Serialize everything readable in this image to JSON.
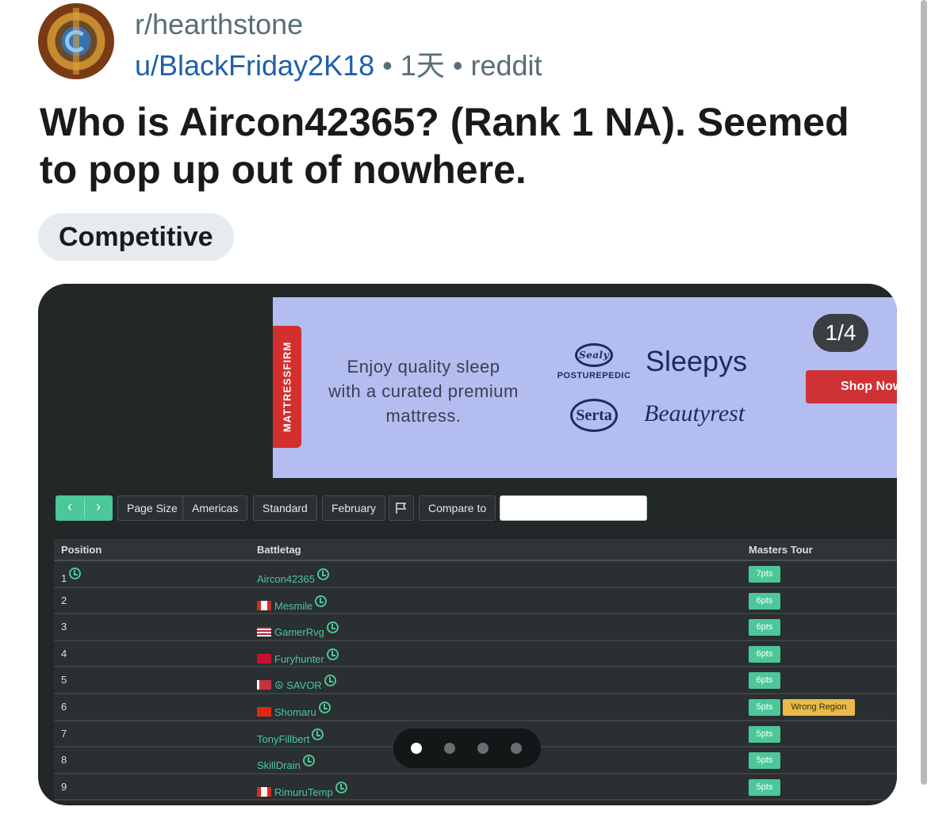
{
  "post": {
    "subreddit": "r/hearthstone",
    "username": "u/BlackFriday2K18",
    "age": "1天",
    "source": "reddit",
    "separator": "•",
    "title": "Who is Aircon42365? (Rank 1 NA). Seemed to pop up out of nowhere.",
    "flair": "Competitive"
  },
  "gallery": {
    "counter": "1/4",
    "current_index": 1,
    "total": 4
  },
  "ad": {
    "brand_logo": "MATTRESSFIRM",
    "tagline": "Enjoy quality sleep with a curated premium mattress.",
    "brands": {
      "sealy_emblem": "Sealy",
      "sealy_sub": "POSTUREPEDIC",
      "sleepys": "Sleepys",
      "serta": "Serta",
      "beautyrest": "Beautyrest"
    },
    "cta": "Shop Now"
  },
  "toolbar": {
    "prev": "‹",
    "next": "›",
    "page_size": "Page Size",
    "region": "Americas",
    "mode": "Standard",
    "month": "February",
    "compare": "Compare to",
    "compare_value": ""
  },
  "table": {
    "headers": {
      "position": "Position",
      "battletag": "Battletag",
      "masters": "Masters Tour"
    },
    "rows": [
      {
        "pos": "1",
        "tag": "Aircon42365",
        "flag": "",
        "pts": "7pts",
        "note": ""
      },
      {
        "pos": "2",
        "tag": "Mesmile",
        "flag": "ca",
        "pts": "6pts",
        "note": ""
      },
      {
        "pos": "3",
        "tag": "GamerRvg",
        "flag": "us",
        "pts": "6pts",
        "note": ""
      },
      {
        "pos": "4",
        "tag": "Furyhunter",
        "flag": "dk",
        "pts": "6pts",
        "note": ""
      },
      {
        "pos": "5",
        "tag": "☮ SAVOR",
        "flag": "by",
        "pts": "6pts",
        "note": ""
      },
      {
        "pos": "6",
        "tag": "Shomaru",
        "flag": "cn",
        "pts": "5pts",
        "note": "Wrong Region"
      },
      {
        "pos": "7",
        "tag": "TonyFillbert",
        "flag": "",
        "pts": "5pts",
        "note": ""
      },
      {
        "pos": "8",
        "tag": "SkillDrain",
        "flag": "",
        "pts": "5pts",
        "note": ""
      },
      {
        "pos": "9",
        "tag": "RimuruTemp",
        "flag": "ca",
        "pts": "5pts",
        "note": ""
      }
    ]
  },
  "colors": {
    "accent_green": "#4bc79a",
    "link_blue": "#1f5fa8",
    "warning_yellow": "#e9b94a",
    "ad_red": "#cf3234"
  }
}
